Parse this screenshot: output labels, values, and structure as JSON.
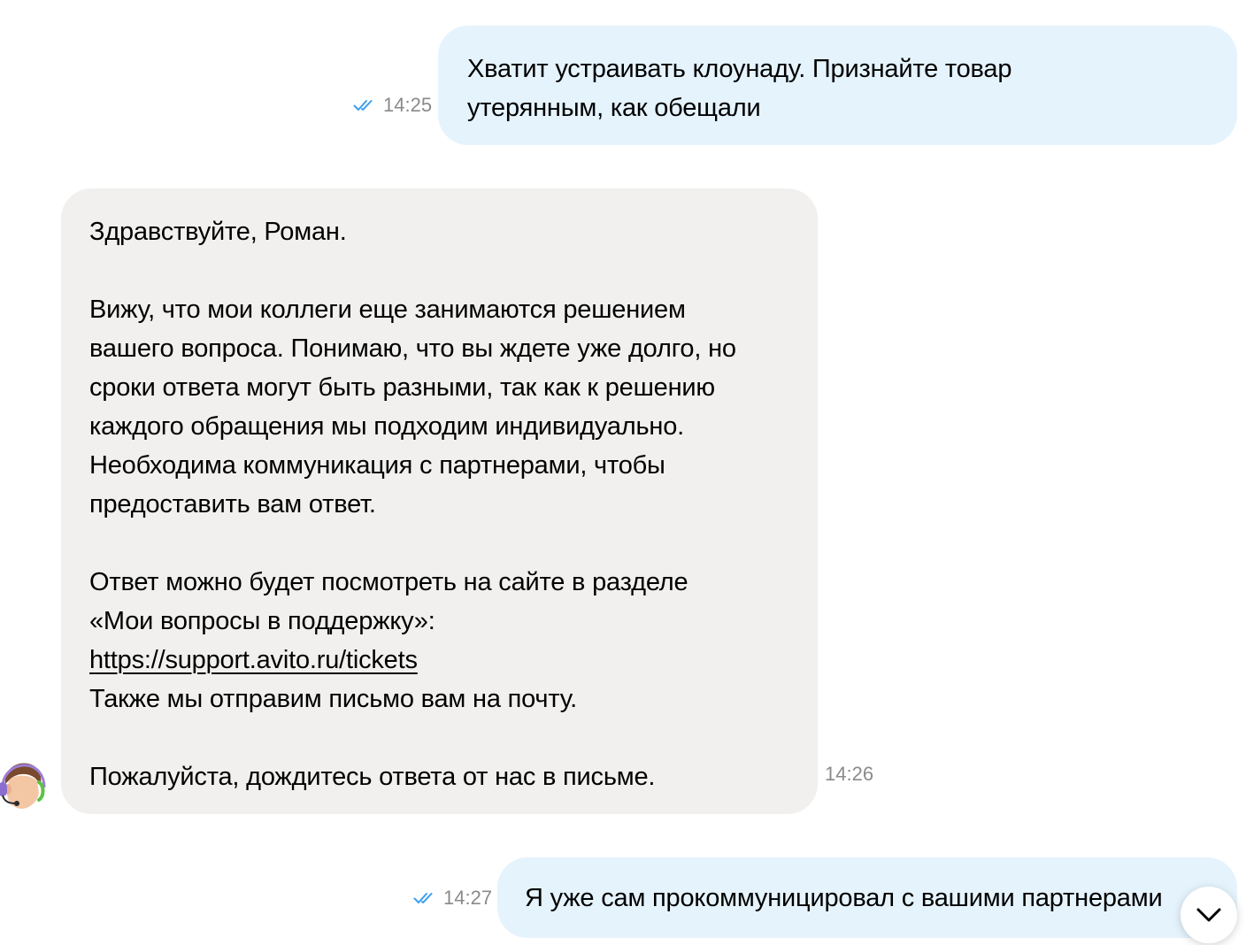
{
  "messages": [
    {
      "direction": "outgoing",
      "lines": [
        "Хватит устраивать клоунаду. Признайте товар",
        "утерянным, как обещали"
      ],
      "time": "14:25",
      "status_icon": "double-check-icon"
    },
    {
      "direction": "incoming",
      "greeting": "Здравствуйте, Роман.",
      "paragraph1": [
        "Вижу, что мои коллеги еще занимаются решением",
        "вашего вопроса. Понимаю, что вы ждете уже долго, но",
        "сроки ответа могут быть разными, так как к решению",
        "каждого обращения мы подходим индивидуально.",
        "Необходима коммуникация с партнерами, чтобы",
        "предоставить вам ответ."
      ],
      "paragraph2": [
        "Ответ можно будет посмотреть на сайте в разделе",
        "«Мои вопросы в поддержку»:"
      ],
      "link": "https://support.avito.ru/tickets",
      "paragraph2_end": "Также мы отправим письмо вам на почту.",
      "closing": "Пожалуйста, дождитесь ответа от нас в письме.",
      "time": "14:26",
      "avatar_icon": "support-agent-avatar"
    },
    {
      "direction": "outgoing",
      "text": "Я уже сам прокоммуницировал с вашими партнерами",
      "time": "14:27",
      "status_icon": "double-check-icon"
    }
  ],
  "scroll_button_icon": "chevron-down-icon",
  "colors": {
    "outgoing_bubble": "#e5f3fd",
    "incoming_bubble": "#f1f0ef",
    "check_blue": "#3a9ff0",
    "meta_gray": "#8a8a8a"
  }
}
